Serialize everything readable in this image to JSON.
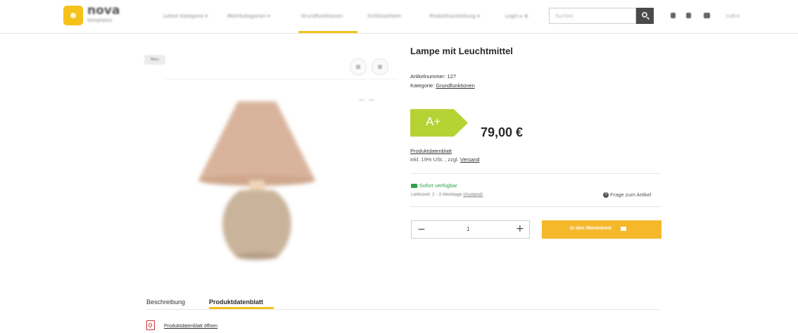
{
  "header": {
    "logo_text": "nova",
    "logo_sub": "templates",
    "nav": [
      {
        "label": "Latest Kategorie ▾"
      },
      {
        "label": "Mehrkategorien ▾"
      },
      {
        "label": "Grundfunktionen"
      },
      {
        "label": "Schlüsselitem"
      },
      {
        "label": "Produktvorstellung ▾"
      },
      {
        "label": "Login ▸ ⊕"
      }
    ],
    "search_placeholder": "Suchen",
    "cart_total": "0,00 €"
  },
  "gallery": {
    "badge": "Neu"
  },
  "product": {
    "title": "Lampe mit Leuchtmittel",
    "article_label": "Artikelnummer:",
    "article_number": "127",
    "category_label": "Kategorie:",
    "category": "Grundfunktionen",
    "energy_class": "A+",
    "energy_color": "#b5d334",
    "price": "79,00 €",
    "datasheet_link": "Produktdatenblatt",
    "tax_text": "inkl. 19% USt. , zzgl.",
    "shipping_link": "Versand",
    "availability": "Sofort verfügbar",
    "lead_time": "Lieferzeit: 2 - 3 Werktage",
    "lead_link": "(Ausland)",
    "question": "Frage zum Artikel",
    "quantity": "1",
    "cart_button": "In den Warenkorb"
  },
  "tabs": [
    {
      "label": "Beschreibung"
    },
    {
      "label": "Produktdatenblatt"
    }
  ],
  "pdf_link": "Produktdatenblatt öffnen",
  "colors": {
    "accent": "#f5c21b",
    "cart_button": "#f5b82b",
    "available": "#2ea34a"
  }
}
